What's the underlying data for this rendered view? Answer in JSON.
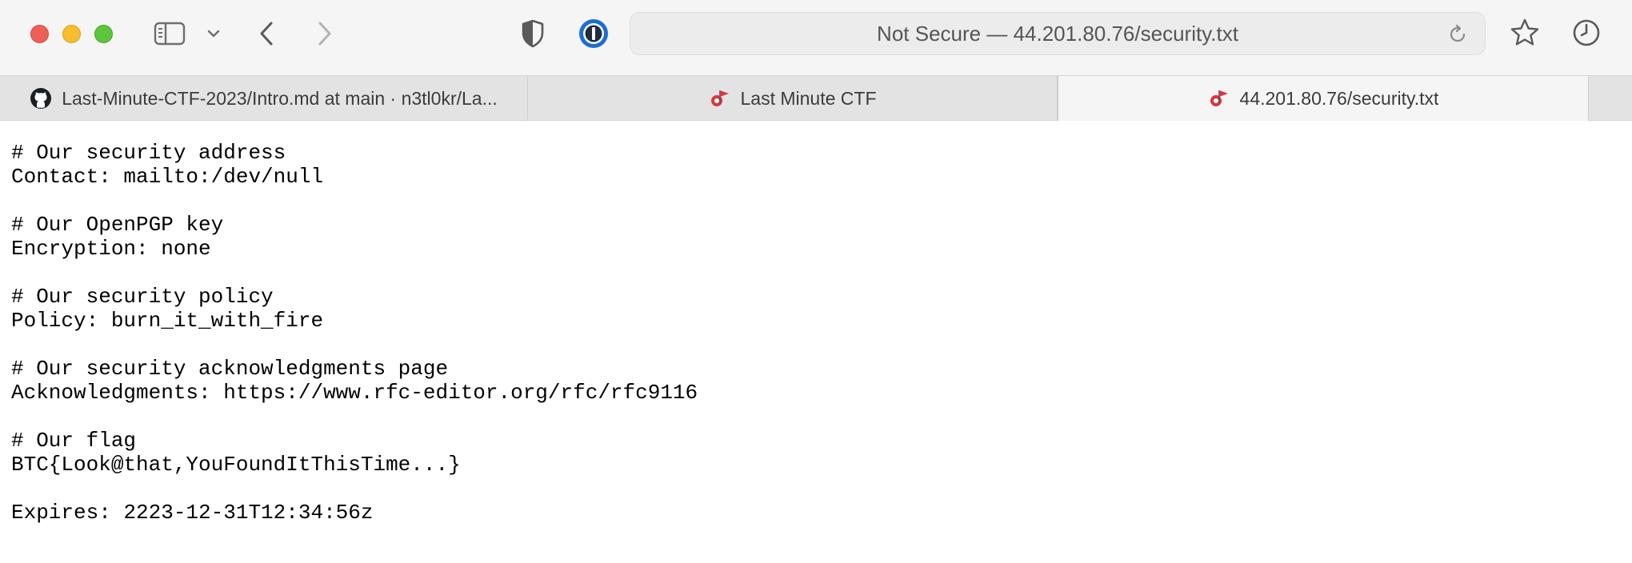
{
  "toolbar": {
    "address": {
      "security_label": "Not Secure",
      "separator": " — ",
      "url": "44.201.80.76/security.txt"
    },
    "icons": [
      "sidebar-icon",
      "chevron-down-icon",
      "back-icon",
      "forward-icon",
      "shield-icon",
      "onepassword-icon",
      "reload-icon",
      "star-icon",
      "history-icon"
    ]
  },
  "tabs": [
    {
      "label": "Last-Minute-CTF-2023/Intro.md at main · n3tl0kr/La...",
      "favicon": "github-icon",
      "active": false
    },
    {
      "label": "Last Minute CTF",
      "favicon": "flag-favicon-icon",
      "active": false
    },
    {
      "label": "44.201.80.76/security.txt",
      "favicon": "flag-favicon-icon",
      "active": true
    }
  ],
  "document": {
    "lines": [
      "# Our security address",
      "Contact: mailto:/dev/null",
      "",
      "# Our OpenPGP key",
      "Encryption: none",
      "",
      "# Our security policy",
      "Policy: burn_it_with_fire",
      "",
      "# Our security acknowledgments page",
      "Acknowledgments: https://www.rfc-editor.org/rfc/rfc9116",
      "",
      "# Our flag",
      "BTC{Look@that,YouFoundItThisTime...}",
      "",
      "Expires: 2223-12-31T12:34:56z"
    ]
  },
  "colors": {
    "close": "#ee5f58",
    "minimize": "#f7bd2d",
    "maximize": "#5ec53e",
    "onepassword": "#1a6ed8",
    "favicon_red": "#d9363e"
  }
}
